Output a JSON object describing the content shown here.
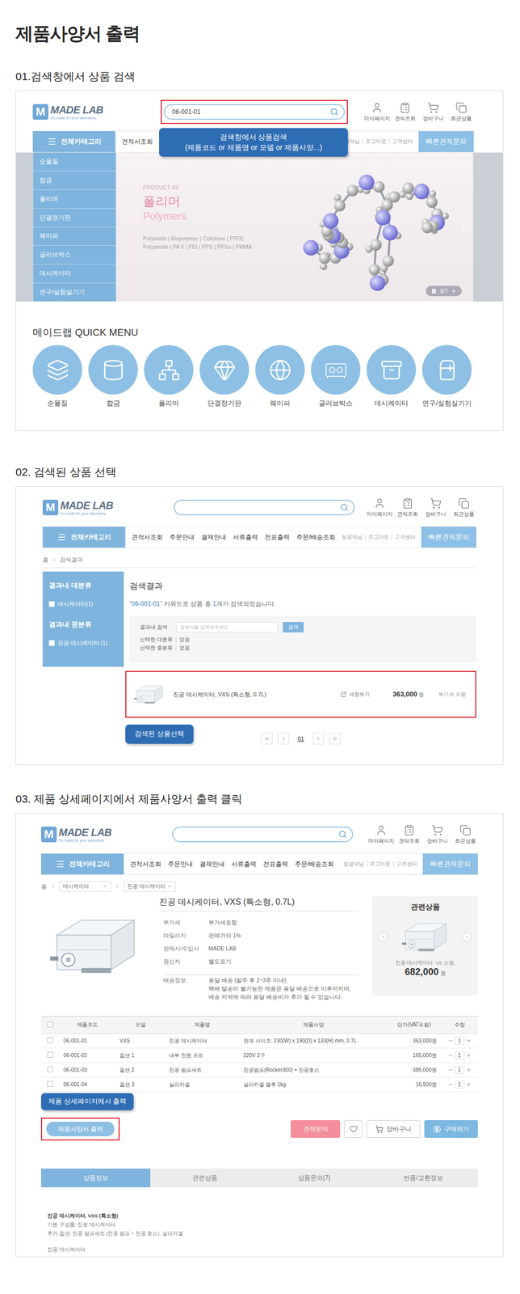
{
  "page": {
    "title": "제품사양서 출력"
  },
  "site": {
    "logo": {
      "mark": "M",
      "name": "MADE LAB",
      "tagline": "It's made for your laboratory."
    },
    "header_links": [
      "마이페이지",
      "견적조회",
      "장바구니",
      "최근상품"
    ],
    "nav": {
      "menu": "전체카테고리",
      "items": [
        "견적서조회",
        "주문안내",
        "결제안내",
        "서류출력",
        "전표출력",
        "주문/배송조회"
      ],
      "user_links": [
        "정경덕님",
        "로그아웃",
        "고객센터"
      ],
      "quick": "빠른견적문의"
    }
  },
  "step1": {
    "heading": "01.검색창에서 상품 검색",
    "search": {
      "value": "06-001-01",
      "highlighted": true
    },
    "callout": {
      "lines": [
        "검색창에서 상품검색",
        "(제품코드 or 제품명 or 모델 or 제품사양...)"
      ]
    },
    "categories": [
      "순물질",
      "합금",
      "폴리머",
      "단결정기판",
      "웨이퍼",
      "글러브박스",
      "데시케이터",
      "연구/실험실기기"
    ],
    "banner": {
      "eyebrow": "PRODUCT 03",
      "title": "폴리머",
      "subtitle": "Polymers",
      "lines": [
        "Polyimide | Biopolymer | Cellulose | PTFE",
        "Polyamide | PA 6 | PEI | PPS | PPSu | PMMA"
      ],
      "pager": "3/7"
    },
    "quick_menu": {
      "title": "메이드랩 QUICK MENU",
      "items": [
        "순물질",
        "합금",
        "폴리머",
        "단결정기판",
        "웨이퍼",
        "글러브박스",
        "데시케이터",
        "연구/실험실기기"
      ]
    }
  },
  "step2": {
    "heading": "02. 검색된 상품 선택",
    "search": {
      "value": "",
      "highlighted": false
    },
    "breadcrumb": [
      "홈",
      "검색결과"
    ],
    "filters": [
      {
        "title": "결과내 대분류",
        "options": [
          {
            "label": "데시케이터(1)",
            "checked": false
          }
        ]
      },
      {
        "title": "결과내 중분류",
        "options": [
          {
            "label": "진공 데시케이터 (1)",
            "checked": false
          }
        ]
      }
    ],
    "results": {
      "title": "검색결과",
      "keyword": "“06-001-01”",
      "summary_before": " 키워드로 상품 총 ",
      "count": "1",
      "summary_after": "개가 검색되었습니다."
    },
    "refine": {
      "label": "결과내 검색",
      "placeholder": "검색어를 입력해주세요",
      "button": "검색",
      "selected": [
        {
          "label": "선택한 대분류",
          "value": "없음"
        },
        {
          "label": "선택한 중분류",
          "value": "없음"
        }
      ]
    },
    "product": {
      "name": "진공 데시케이터, VXS (특소형, 0.7L)",
      "view": "새창보기",
      "price": "363,000",
      "unit": "원",
      "tax": "부가세 포함",
      "highlighted": true
    },
    "callout": {
      "lines": [
        "검색된 상품선택"
      ]
    },
    "pagination": [
      {
        "label": "01",
        "selected": true
      }
    ]
  },
  "step3": {
    "heading": "03. 제품 상세페이지에서 제품사양서 출력 클릭",
    "search": {
      "value": "",
      "highlighted": false
    },
    "breadcrumb": {
      "home": "홈",
      "levels": [
        "데시케이터",
        "진공 데시케이터"
      ]
    },
    "product": {
      "title": "진공 데시케이터, VXS (특소형, 0.7L)",
      "info": [
        {
          "label": "부가세",
          "lines": [
            "부가세포함"
          ]
        },
        {
          "label": "마일리지",
          "lines": [
            "판매가의 1%"
          ]
        },
        {
          "label": "판매사/수입사",
          "lines": [
            "MADE LAB"
          ]
        },
        {
          "label": "원산지",
          "lines": [
            "별도표기"
          ]
        },
        {
          "label": "배송정보",
          "lines": [
            "용달 배송 (발주 후 2~3주 이내)",
            "택배 발송이 불가능한 제품은 용달 배송으로 이루어지며,",
            "배송 지역에 따라 용달 배송비가 추가 될 수 있습니다."
          ]
        }
      ]
    },
    "related": {
      "title": "관련상품",
      "name": "진공 데시케이터, VS 소형,",
      "price": "682,000",
      "unit": "원"
    },
    "table": {
      "header_checked": false,
      "columns": [
        "제품코드",
        "모델",
        "제품명",
        "제품사양",
        "단가(VAT포함)",
        "수량"
      ],
      "rows": [
        {
          "code": "06-001-01",
          "model": "VXS",
          "name": "진공 데시케이터",
          "spec": "전체 사이즈: 230(W) x 190(D) x 133(H) mm, 0.7L",
          "price": "363,000원",
          "qty": "1",
          "checked": false
        },
        {
          "code": "06-001-02",
          "model": "옵션 1",
          "name": "내부 전원 포트",
          "spec": "220V 2구",
          "price": "165,000원",
          "qty": "1",
          "checked": false
        },
        {
          "code": "06-001-03",
          "model": "옵션 2",
          "name": "진공 펌프세트",
          "spec": "진공펌프(Rocker300) + 진공호스",
          "price": "385,000원",
          "qty": "1",
          "checked": false
        },
        {
          "code": "06-001-04",
          "model": "옵션 3",
          "name": "실리카겔",
          "spec": "실리카겔 블루 1kg",
          "price": "16,500원",
          "qty": "1",
          "checked": false
        }
      ]
    },
    "print_button": {
      "label": "제품사양서 출력",
      "highlighted": true
    },
    "callout": {
      "lines": [
        "제품 상세페이지에서 출력"
      ]
    },
    "actions": {
      "quote": "견적문의",
      "wish_selected": false,
      "cart": "장바구니",
      "buy": "구매하기"
    },
    "tabs": [
      {
        "label": "상품정보",
        "selected": true
      },
      {
        "label": "관련상품",
        "selected": false
      },
      {
        "label": "상품문의(7)",
        "selected": false
      },
      {
        "label": "반품/교환정보",
        "selected": false
      }
    ],
    "description": [
      "진공 데시케이터, VXS (특소형)",
      "기본 구성품: 진공 데시케이터",
      "추가 옵션: 진공 펌프세트 (진공 펌프 + 진공 호스), 실리카겔",
      "진공 데시케이터"
    ]
  }
}
